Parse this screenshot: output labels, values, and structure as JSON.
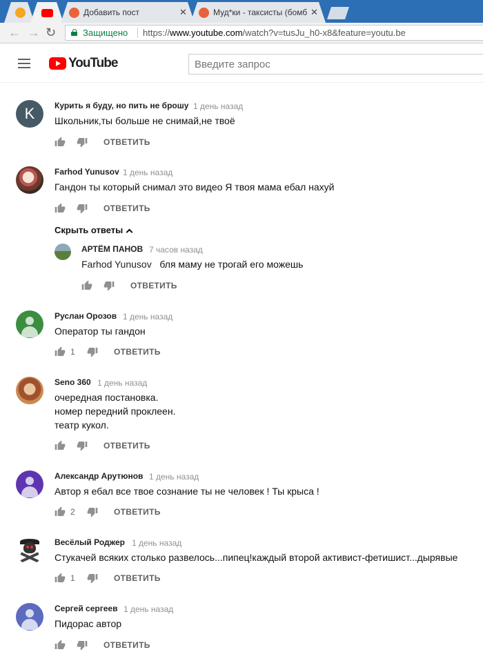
{
  "browser": {
    "tabs": [
      {
        "title": "",
        "favicon_color": "#f5a623"
      },
      {
        "title": "",
        "favicon_color": "#ff0000"
      },
      {
        "title": "Добавить пост",
        "favicon_color": "#e8623a"
      },
      {
        "title": "Муд*ки - таксисты (бомб",
        "favicon_color": "#e8623a"
      }
    ],
    "secure_label": "Защищено",
    "url_scheme": "https://",
    "url_host": "www.youtube.com",
    "url_path": "/watch?v=tusJu_h0-x8&feature=youtu.be"
  },
  "youtube": {
    "logo_text": "YouTube",
    "search_placeholder": "Введите запрос",
    "accent_color": "#ff0000"
  },
  "reply_label": "ОТВЕТИТЬ",
  "hide_replies_label": "Скрыть ответы",
  "comments": [
    {
      "author": "Курить я буду, но пить не брошу",
      "time": "1 день назад",
      "lines": [
        "Школьник,ты больше не снимай,не твоё"
      ],
      "likes": "",
      "avatar_letter": "K"
    },
    {
      "author": "Farhod Yunusov",
      "time": "1 день назад",
      "lines": [
        "Гандон ты который снимал это видео Я твоя мама ебал нахуй"
      ],
      "likes": ""
    },
    {
      "author": "Руслан Орозов",
      "time": "1 день назад",
      "lines": [
        "Оператор ты гандон"
      ],
      "likes": "1"
    },
    {
      "author": "Seno 360",
      "time": "1 день назад",
      "lines": [
        "очередная постановка.",
        "номер передний проклеен.",
        "театр кукол."
      ],
      "likes": ""
    },
    {
      "author": "Александр Арутюнов",
      "time": "1 день назад",
      "lines": [
        "Автор я ебал все твое сознание ты не человек ! Ты крыса !"
      ],
      "likes": "2"
    },
    {
      "author": "Весёлый Роджер",
      "time": "1 день назад",
      "lines": [
        "Стукачей всяких столько развелось...пипец!каждый второй активист-фетишист...дырявые"
      ],
      "likes": "1"
    },
    {
      "author": "Сергей сергеев",
      "time": "1 день назад",
      "lines": [
        "Пидорас автор"
      ],
      "likes": ""
    }
  ],
  "reply": {
    "author": "АРТЁМ ПАНОВ",
    "time": "7 часов назад",
    "mention": "Farhod Yunusov",
    "text": "бля маму не трогай его можешь",
    "likes": ""
  },
  "avatar_colors": {
    "letter_k": "#455a64",
    "ruslan": "#3c8d40",
    "aleksandr": "#5e35b1",
    "sergey": "#5c6bc0"
  }
}
